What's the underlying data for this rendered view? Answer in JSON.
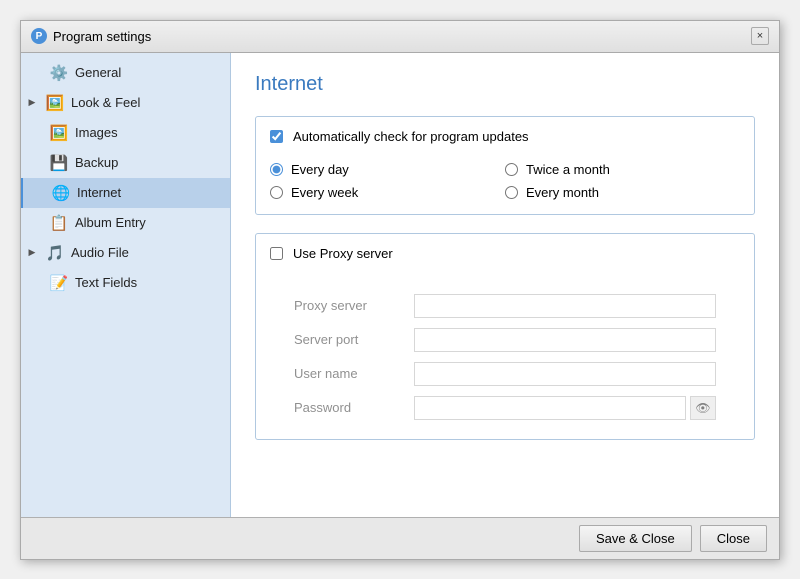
{
  "window": {
    "title": "Program settings",
    "close_label": "×"
  },
  "sidebar": {
    "items": [
      {
        "id": "general",
        "label": "General",
        "icon": "⚙️",
        "arrow": false,
        "active": false
      },
      {
        "id": "look-feel",
        "label": "Look & Feel",
        "icon": "🖼️",
        "arrow": true,
        "active": false
      },
      {
        "id": "images",
        "label": "Images",
        "icon": "🖼️",
        "arrow": false,
        "active": false
      },
      {
        "id": "backup",
        "label": "Backup",
        "icon": "💾",
        "arrow": false,
        "active": false
      },
      {
        "id": "internet",
        "label": "Internet",
        "icon": "🌐",
        "arrow": false,
        "active": true
      },
      {
        "id": "album-entry",
        "label": "Album Entry",
        "icon": "📋",
        "arrow": false,
        "active": false
      },
      {
        "id": "audio-file",
        "label": "Audio File",
        "icon": "🎵",
        "arrow": true,
        "active": false
      },
      {
        "id": "text-fields",
        "label": "Text Fields",
        "icon": "📝",
        "arrow": false,
        "active": false
      }
    ]
  },
  "main": {
    "title": "Internet",
    "auto_update": {
      "label": "Automatically check for program updates",
      "checked": true,
      "frequencies": [
        {
          "id": "every-day",
          "label": "Every day",
          "checked": true
        },
        {
          "id": "twice-month",
          "label": "Twice a month",
          "checked": false
        },
        {
          "id": "every-week",
          "label": "Every week",
          "checked": false
        },
        {
          "id": "every-month",
          "label": "Every month",
          "checked": false
        }
      ]
    },
    "proxy": {
      "label": "Use Proxy server",
      "checked": false,
      "fields": [
        {
          "id": "proxy-server",
          "label": "Proxy server",
          "value": "",
          "placeholder": ""
        },
        {
          "id": "server-port",
          "label": "Server port",
          "value": "",
          "placeholder": ""
        },
        {
          "id": "user-name",
          "label": "User name",
          "value": "",
          "placeholder": ""
        },
        {
          "id": "password",
          "label": "Password",
          "value": "",
          "placeholder": ""
        }
      ]
    }
  },
  "footer": {
    "save_close_label": "Save & Close",
    "close_label": "Close"
  }
}
